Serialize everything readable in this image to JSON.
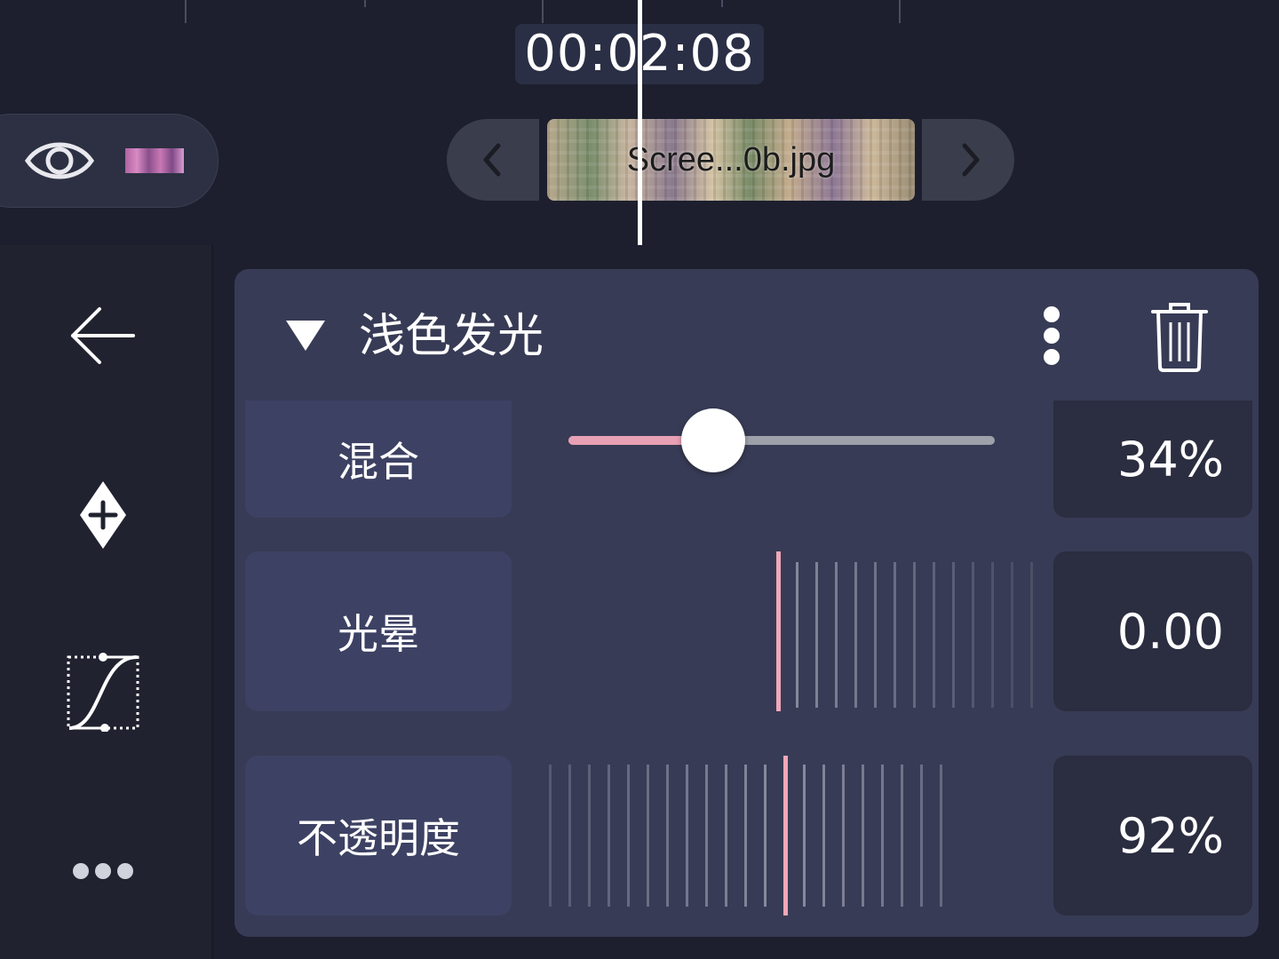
{
  "timeline": {
    "timecode": "00:02:08",
    "clip_name": "Scree...0b.jpg"
  },
  "effect_panel": {
    "title": "浅色发光",
    "params": {
      "blend": {
        "label": "混合",
        "value_text": "34%",
        "level": 0.34
      },
      "halo": {
        "label": "光晕",
        "value_text": "0.00"
      },
      "opacity": {
        "label": "不透明度",
        "value_text": "92%"
      }
    }
  },
  "colors": {
    "background": "#1d1f2e",
    "panel": "#383b55",
    "accent_pink": "#f0a8b8",
    "value_box": "#2b2d40"
  },
  "icons": {
    "layer_visibility": "eye-icon",
    "back": "arrow-left-icon",
    "keyframe": "keyframe-add-icon",
    "easing": "bezier-curve-icon",
    "more": "more-horizontal-icon",
    "panel_more": "more-vertical-icon",
    "delete": "trash-icon",
    "collapse": "triangle-down-icon",
    "prev": "chevron-left-icon",
    "next": "chevron-right-icon"
  }
}
